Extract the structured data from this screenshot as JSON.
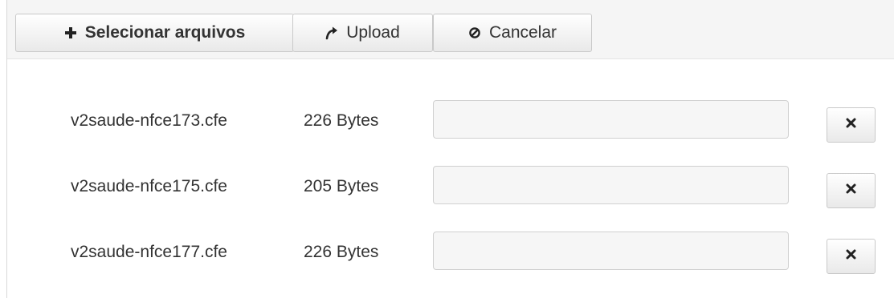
{
  "toolbar": {
    "select_label": "Selecionar arquivos",
    "upload_label": "Upload",
    "cancel_label": "Cancelar",
    "select_icon": "plus-icon",
    "upload_icon": "upload-arrow-icon",
    "cancel_icon": "cancel-circle-icon"
  },
  "files": [
    {
      "name": "v2saude-nfce173.cfe",
      "size": "226 Bytes",
      "progress": 0
    },
    {
      "name": "v2saude-nfce175.cfe",
      "size": "205 Bytes",
      "progress": 0
    },
    {
      "name": "v2saude-nfce177.cfe",
      "size": "226 Bytes",
      "progress": 0
    }
  ],
  "remove_icon": "close-icon",
  "colors": {
    "toolbar_bg": "#f5f5f5",
    "text": "#333333",
    "border": "#c9c9c9",
    "progress_bg": "#f6f6f6"
  }
}
